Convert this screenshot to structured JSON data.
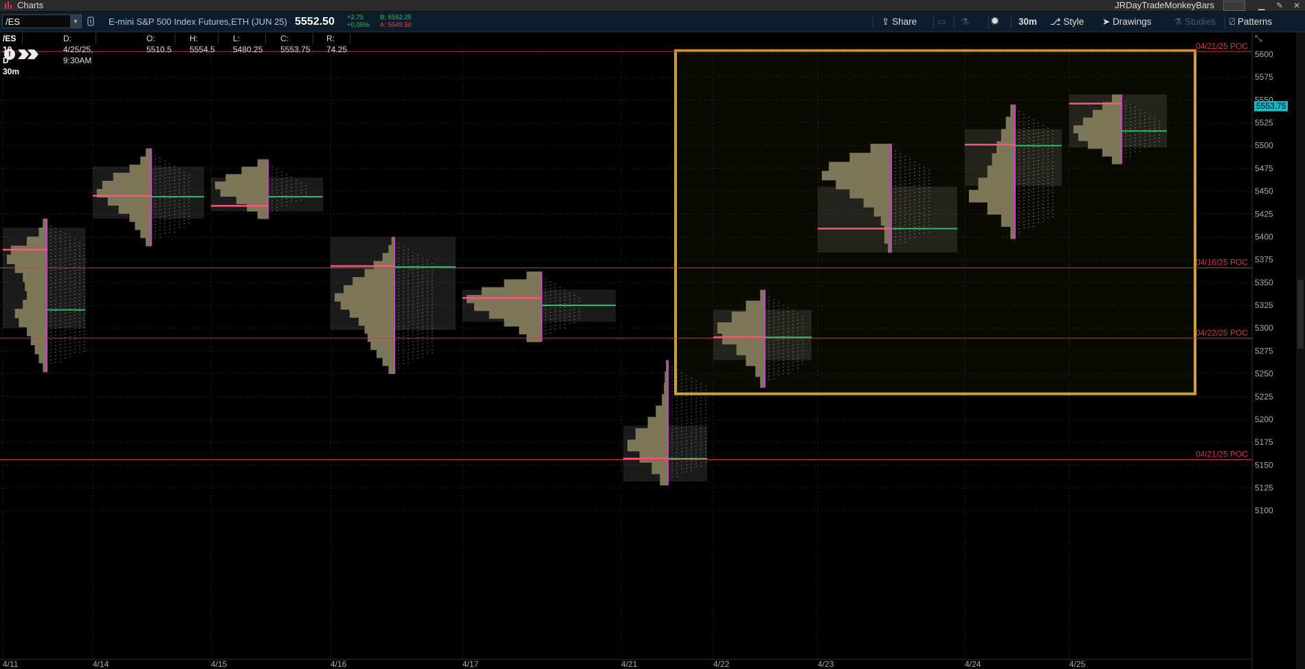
{
  "window": {
    "app_title": "Charts",
    "user_name": "JRDayTradeMonkeyBars"
  },
  "toolbar": {
    "symbol": "/ES",
    "description": "E-mini S&P 500 Index Futures,ETH (JUN 25)",
    "last_price": "5552.50",
    "net_change": "+2.75",
    "net_change_pct": "+0.05%",
    "bid": "B: 5552.25",
    "ask": "A: 5549.50",
    "share_label": "Share",
    "aggregation_label": "30m",
    "style_label": "Style",
    "drawings_label": "Drawings",
    "studies_label": "Studies",
    "patterns_label": "Patterns"
  },
  "info_bar": {
    "study_label": "/ES 10 D 30m",
    "date": "D: 4/25/25, 9:30АМ",
    "open": "O: 5510.5",
    "high": "H: 5554.5",
    "low": "L: 5480.25",
    "close": "C: 5553.75",
    "range": "R: 74.25"
  },
  "colors": {
    "background": "#000000",
    "grid": "#3a3a3a",
    "profile_fill": "#7d7658",
    "poc_line": "#ff5577",
    "value_area_box": "rgba(150,150,150,0.18)",
    "vwap_line": "#25c06a",
    "magenta_marker": "#d23bd2",
    "reference_line": "#e0304a",
    "reference_label": "#e0304a",
    "selection_box": "#c9a227",
    "selection_fill": "rgba(90,80,10,0.12)",
    "axis_text": "#aaaaaa",
    "last_price_badge": "#12b8c6"
  },
  "chart_data": {
    "type": "market-profile",
    "price_axis": {
      "range": [
        5085,
        5610
      ],
      "ticks": [
        5100,
        5125,
        5150,
        5175,
        5200,
        5225,
        5250,
        5275,
        5300,
        5325,
        5350,
        5375,
        5400,
        5425,
        5450,
        5475,
        5500,
        5525,
        5550,
        5575,
        5600
      ],
      "last_price_label": "5553.75"
    },
    "date_axis": [
      "4/11",
      "4/14",
      "4/15",
      "4/16",
      "4/17",
      "4/21",
      "4/22",
      "4/23",
      "4/24",
      "4/25"
    ],
    "reference_lines": [
      {
        "label": "04/16/25  POC",
        "price": 5366
      },
      {
        "label": "04/22/25  POC",
        "price": 5289
      },
      {
        "label": "04/21/25  POC",
        "price": 5156
      },
      {
        "label": "04/21/25  POC",
        "price": 5603
      }
    ],
    "profiles": [
      {
        "date": "4/11",
        "high": 5420,
        "low": 5252,
        "poc": 5386,
        "va_high": 5410,
        "va_low": 5300,
        "vwap": 5320,
        "shape": [
          0.1,
          0.2,
          0.5,
          0.9,
          1,
          0.8,
          0.6,
          0.55,
          0.5,
          0.6,
          0.8,
          0.7,
          0.5,
          0.4,
          0.3,
          0.2,
          0.1
        ]
      },
      {
        "date": "4/14",
        "high": 5497,
        "low": 5390,
        "poc": 5445,
        "va_high": 5477,
        "va_low": 5420,
        "vwap": 5444,
        "shape": [
          0.1,
          0.2,
          0.4,
          0.7,
          0.9,
          1,
          0.8,
          0.6,
          0.4,
          0.3,
          0.2,
          0.1
        ]
      },
      {
        "date": "4/15",
        "high": 5485,
        "low": 5420,
        "poc": 5434,
        "va_high": 5465,
        "va_low": 5428,
        "vwap": 5444,
        "shape": [
          0.2,
          0.5,
          0.8,
          1,
          0.9,
          0.6,
          0.4,
          0.2
        ]
      },
      {
        "date": "4/16",
        "high": 5400,
        "low": 5250,
        "poc": 5368,
        "va_high": 5400,
        "va_low": 5298,
        "vwap": 5367,
        "shape": [
          0.05,
          0.1,
          0.2,
          0.35,
          0.5,
          0.7,
          0.85,
          1,
          0.9,
          0.75,
          0.6,
          0.5,
          0.45,
          0.4,
          0.3,
          0.2,
          0.1
        ]
      },
      {
        "date": "4/17",
        "high": 5362,
        "low": 5285,
        "poc": 5333,
        "va_high": 5342,
        "va_low": 5307,
        "vwap": 5325,
        "shape": [
          0.2,
          0.5,
          0.8,
          1,
          0.9,
          0.7,
          0.5,
          0.3,
          0.2
        ]
      },
      {
        "date": "4/21",
        "high": 5265,
        "low": 5128,
        "poc": 5157,
        "va_high": 5193,
        "va_low": 5132,
        "vwap": 5157,
        "shape": [
          0.05,
          0.08,
          0.1,
          0.15,
          0.3,
          0.5,
          0.8,
          1,
          0.7,
          0.4,
          0.2
        ]
      },
      {
        "date": "4/22",
        "high": 5342,
        "low": 5235,
        "poc": 5290,
        "va_high": 5320,
        "va_low": 5265,
        "vwap": 5290,
        "shape": [
          0.1,
          0.4,
          0.7,
          1,
          0.9,
          0.6,
          0.4,
          0.2,
          0.1
        ]
      },
      {
        "date": "4/23",
        "high": 5502,
        "low": 5383,
        "poc": 5409,
        "va_high": 5455,
        "va_low": 5383,
        "vwap": 5409,
        "shape": [
          0.3,
          0.6,
          0.9,
          1,
          0.8,
          0.6,
          0.4,
          0.25,
          0.15,
          0.1,
          0.1,
          0.05
        ]
      },
      {
        "date": "4/24",
        "high": 5545,
        "low": 5398,
        "poc": 5501,
        "va_high": 5518,
        "va_low": 5456,
        "vwap": 5500,
        "shape": [
          0.1,
          0.2,
          0.3,
          0.4,
          0.5,
          0.6,
          0.8,
          1,
          0.6,
          0.3,
          0.1
        ]
      },
      {
        "date": "4/25",
        "high": 5556,
        "low": 5480,
        "poc": 5546,
        "va_high": 5556,
        "va_low": 5498,
        "vwap": 5516,
        "shape": [
          0.2,
          0.4,
          0.6,
          0.8,
          1,
          0.9,
          0.7,
          0.4,
          0.2
        ]
      }
    ],
    "selection_box": {
      "from": "4/21",
      "to": "4/25",
      "price_high": 5604,
      "price_low": 5228
    }
  }
}
